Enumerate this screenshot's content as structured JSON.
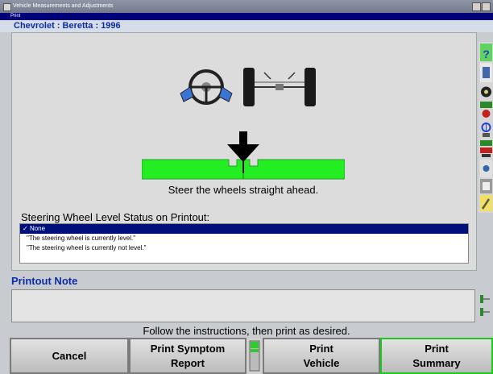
{
  "window": {
    "title": "Vehicle Measurements and Adjustments",
    "subtitle": "Print"
  },
  "vehicle": {
    "name": "Chevrolet : Beretta : 1996"
  },
  "main": {
    "instruction": "Steer the wheels straight ahead.",
    "status_label": "Steering Wheel Level Status on Printout:",
    "options": [
      "None",
      "\"The steering wheel is currently level.\"",
      "\"The steering wheel is currently not level.\""
    ],
    "selected_option": 0
  },
  "note": {
    "label": "Printout Note",
    "value": ""
  },
  "footer": {
    "message": "Follow the instructions, then print as desired."
  },
  "buttons": {
    "cancel": "Cancel",
    "print_symptom": "Print Symptom\nReport",
    "print_vehicle": "Print\nVehicle",
    "print_summary": "Print\nSummary"
  },
  "toolbar_icons": [
    "help-icon",
    "readings-icon",
    "tire-icon",
    "caster-icon",
    "camber-icon",
    "toe-icon",
    "settings-icon",
    "adjust-icon",
    "wrench-icon"
  ],
  "colors": {
    "accent": "#0a2ca8",
    "gauge_green": "#22ee22",
    "selection": "#00107a"
  }
}
